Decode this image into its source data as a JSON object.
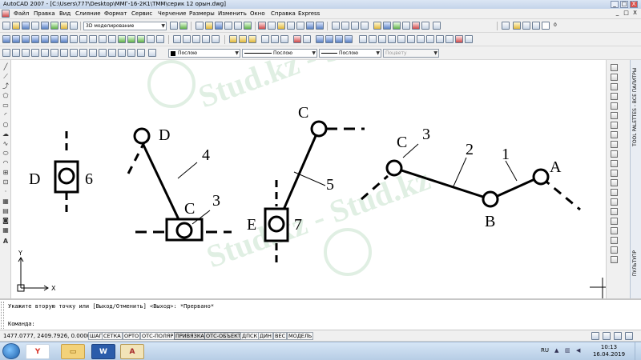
{
  "window": {
    "title": "AutoCAD 2007 - [C:\\Users\\777\\Desktop\\ММГ-16-2К1\\ТММ\\серик 12 орын.dwg]",
    "controls": {
      "minimize": "_",
      "restore": "□",
      "close": "X"
    }
  },
  "menu": {
    "items": [
      "Файл",
      "Правка",
      "Вид",
      "Слияние",
      "Формат",
      "Сервис",
      "Черчение",
      "Размеры",
      "Изменить",
      "Окно",
      "Справка",
      "Express"
    ],
    "doc_controls": {
      "minimize": "_",
      "restore": "□",
      "close": "X"
    }
  },
  "toolbar": {
    "workspace": "3D моделирование",
    "layer_value": "0",
    "color": "Послою",
    "linetype": "Послою",
    "lineweight": "Послою",
    "plotstyle": "Поцвету"
  },
  "drawing": {
    "labels": {
      "mech1_point": "D",
      "mech1_num": "6",
      "mech2_top": "D",
      "mech2_link": "4",
      "mech2_slider": "C",
      "mech2_slider_num": "3",
      "mech3_top": "C",
      "mech3_link": "5",
      "mech3_point": "E",
      "mech3_num": "7",
      "mech4_c": "C",
      "mech4_c_num": "3",
      "mech4_link2": "2",
      "mech4_link1": "1",
      "mech4_a": "A",
      "mech4_b": "B"
    },
    "ucs": {
      "x": "X",
      "y": "Y"
    },
    "watermark": "Stud.kz - Stud.kz"
  },
  "palette": {
    "tool_palettes": "TOOL PALETTES - ВСЕ ПАЛИТРЫ",
    "console": "ПУЛЬТУПР"
  },
  "command": {
    "history": "Укажите вторую точку или [Выход/Отменить] <Выход>: *Прервано*",
    "prompt": "Команда:"
  },
  "status": {
    "coordinates": "1477.0777, 2409.7926, 0.0000",
    "buttons": [
      "ШАГ",
      "СЕТКА",
      "ОРТО",
      "ОТС-ПОЛЯР",
      "ПРИВЯЗКА",
      "ОТС-ОБЪЕКТ",
      "ДПСК",
      "ДИН",
      "ВЕС",
      "МОДЕЛЬ"
    ],
    "active": [
      "ПРИВЯЗКА",
      "ОТС-ОБЪЕКТ"
    ]
  },
  "taskbar": {
    "apps": [
      {
        "name": "yandex",
        "glyph": "Y",
        "color": "#d9362b"
      },
      {
        "name": "explorer",
        "glyph": "▭",
        "color": "#d8a637"
      },
      {
        "name": "word",
        "glyph": "W",
        "color": "#2b5caa"
      },
      {
        "name": "autocad",
        "glyph": "A",
        "color": "#a52a2a"
      }
    ],
    "language": "RU",
    "time": "10:13",
    "date": "16.04.2019"
  }
}
